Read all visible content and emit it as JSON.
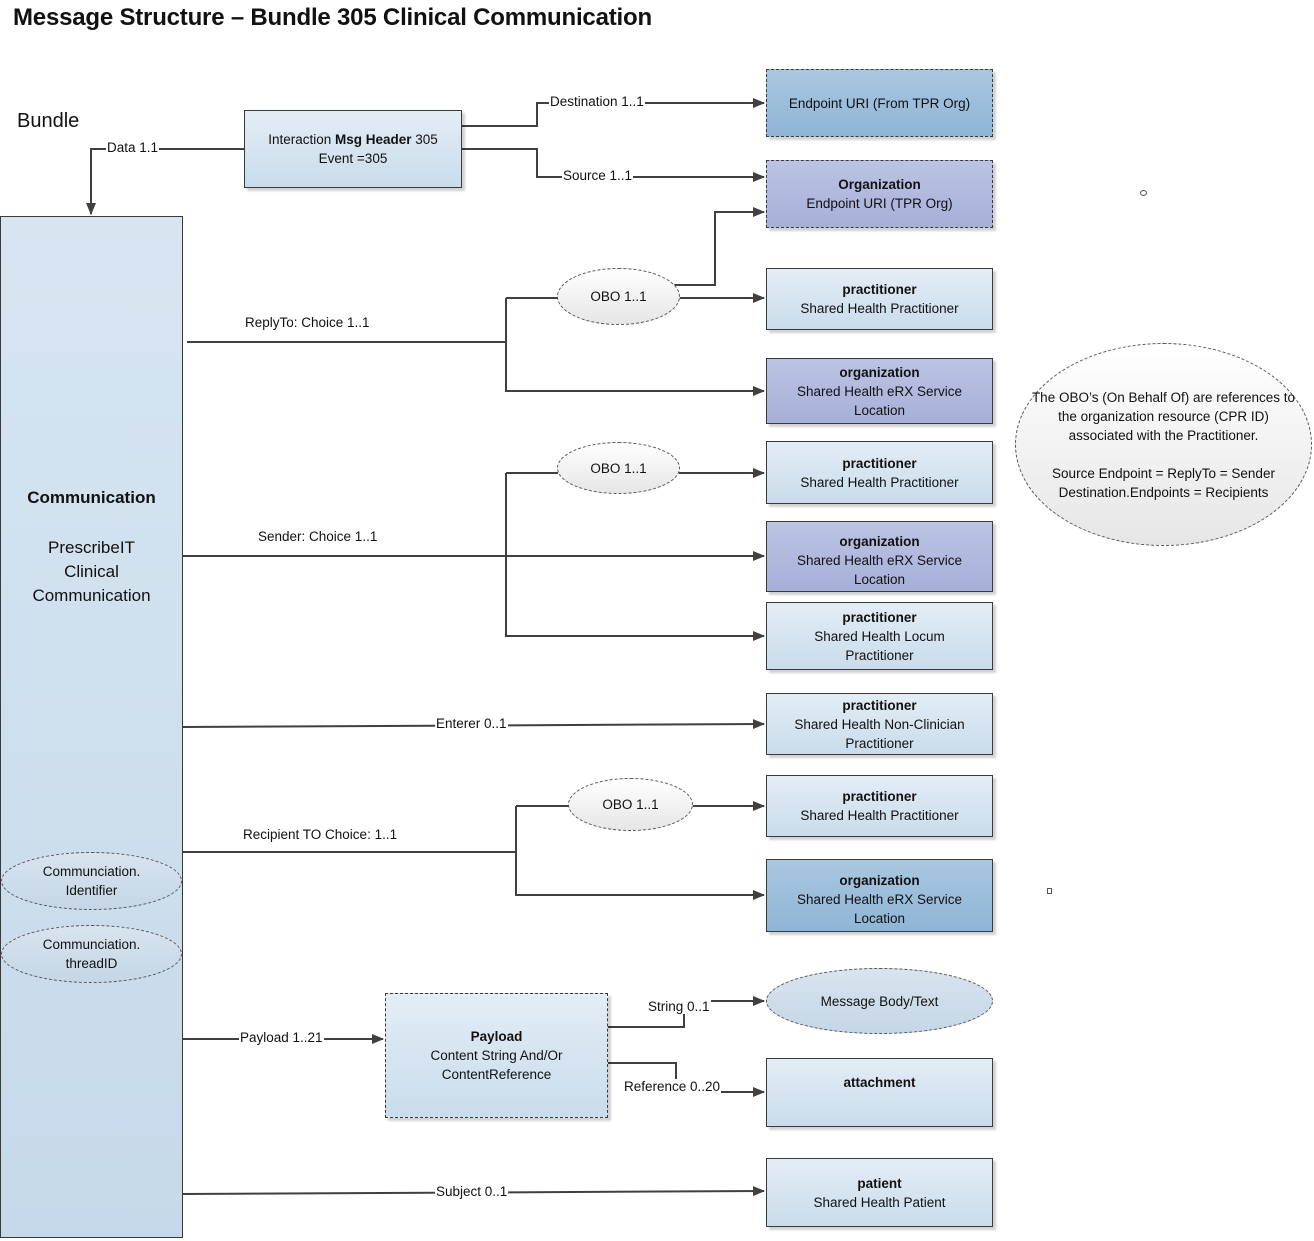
{
  "title": "Message Structure – Bundle 305 Clinical Communication",
  "bundle_label": "Bundle",
  "msg_header": {
    "line1_prefix": "Interaction ",
    "line1_bold": "Msg Header",
    "line1_suffix": " 305",
    "line2": "Event =305"
  },
  "links": {
    "data": "Data 1.1",
    "destination": "Destination 1..1",
    "source": "Source 1..1",
    "reply_to": "ReplyTo:  Choice 1..1",
    "sender": "Sender:  Choice  1..1",
    "enterer": "Enterer 0..1",
    "recipient": "Recipient TO Choice:   1..1",
    "payload": "Payload 1..21",
    "string": "String 0..1",
    "reference": "Reference 0..20",
    "subject": "Subject 0..1"
  },
  "communication": {
    "title": "Communication",
    "subtitle_lines": [
      "PrescribeIT",
      "Clinical",
      "Communication"
    ],
    "identifier": [
      "Communciation.",
      "Identifier"
    ],
    "thread": [
      "Communciation.",
      "threadID"
    ]
  },
  "obo_label": "OBO   1..1",
  "nodes": {
    "endpoint_dest": {
      "title": "",
      "text": "Endpoint URI (From TPR Org)",
      "color": "#9dbfdc"
    },
    "org_source": {
      "title": "Organization",
      "text": "Endpoint URI (TPR Org)",
      "color": "#b1b9de"
    },
    "reply_practitioner": {
      "title": "practitioner",
      "text": "Shared Health Practitioner",
      "color": "#d6e4f0"
    },
    "reply_org": {
      "title": "organization",
      "text": "Shared Health eRX Service Location",
      "color": "#b1b9de"
    },
    "sender_practitioner": {
      "title": "practitioner",
      "text": "Shared Health Practitioner",
      "color": "#d6e4f0"
    },
    "sender_org": {
      "title": "organization",
      "text": "Shared Health eRX Service Location",
      "color": "#b1b9de"
    },
    "sender_locum": {
      "title": "practitioner",
      "text": "Shared Health Locum Practitioner",
      "color": "#d6e4f0"
    },
    "enterer_practitioner": {
      "title": "practitioner",
      "text": "Shared Health Non-Clinician Practitioner",
      "color": "#d6e4f0"
    },
    "recipient_practitioner": {
      "title": "practitioner",
      "text": "Shared Health Practitioner",
      "color": "#d6e4f0"
    },
    "recipient_org": {
      "title": "organization",
      "text": "Shared Health eRX Service Location",
      "color": "#9dbfdc"
    },
    "payload": {
      "title": "Payload",
      "text": "Content String And/Or ContentReference",
      "color": "#d6e4f0"
    },
    "message_body": {
      "title": "",
      "text": "Message Body/Text",
      "color": "#cbdbea"
    },
    "attachment": {
      "title": "attachment",
      "text": "",
      "color": "#d6e4f0"
    },
    "patient": {
      "title": "patient",
      "text": "Shared Health Patient",
      "color": "#d6e4f0"
    }
  },
  "note": {
    "para1": "The OBO’s (On Behalf Of) are references to the organization resource (CPR ID) associated with the Practitioner.",
    "para2_line1": "Source Endpoint = ReplyTo = Sender",
    "para2_line2": "Destination.Endpoints = Recipients"
  }
}
